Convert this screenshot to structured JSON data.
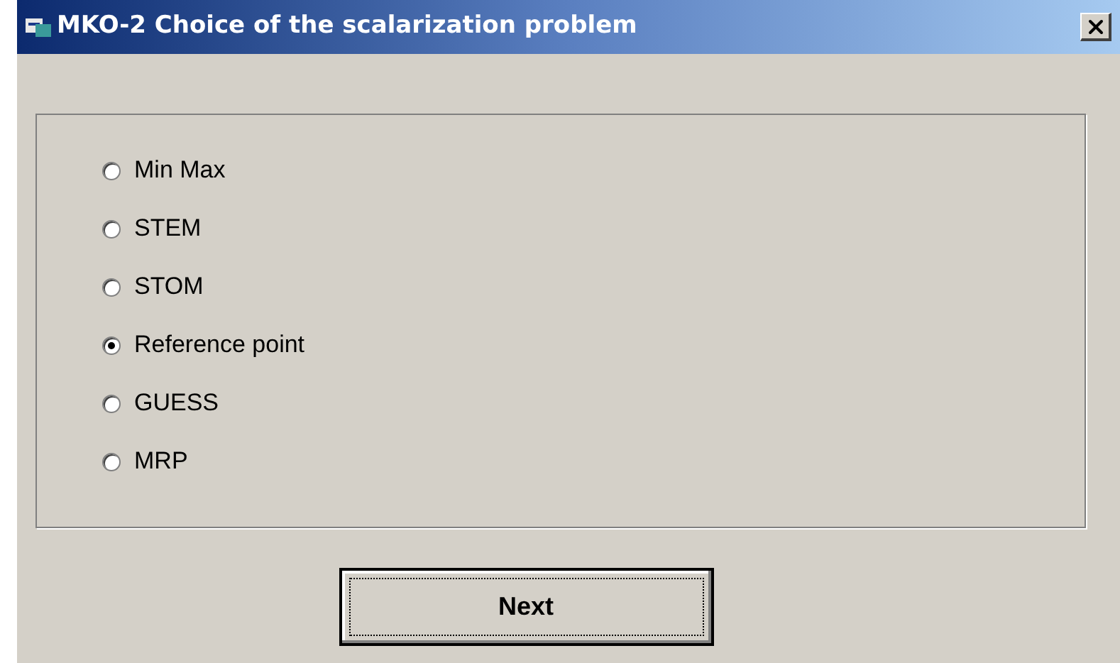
{
  "window": {
    "title": "MKO-2 Choice of the scalarization problem"
  },
  "options": [
    {
      "label": "Min Max",
      "selected": false
    },
    {
      "label": "STEM",
      "selected": false
    },
    {
      "label": "STOM",
      "selected": false
    },
    {
      "label": "Reference point",
      "selected": true
    },
    {
      "label": "GUESS",
      "selected": false
    },
    {
      "label": "MRP",
      "selected": false
    }
  ],
  "buttons": [
    {
      "label": "Next"
    }
  ]
}
